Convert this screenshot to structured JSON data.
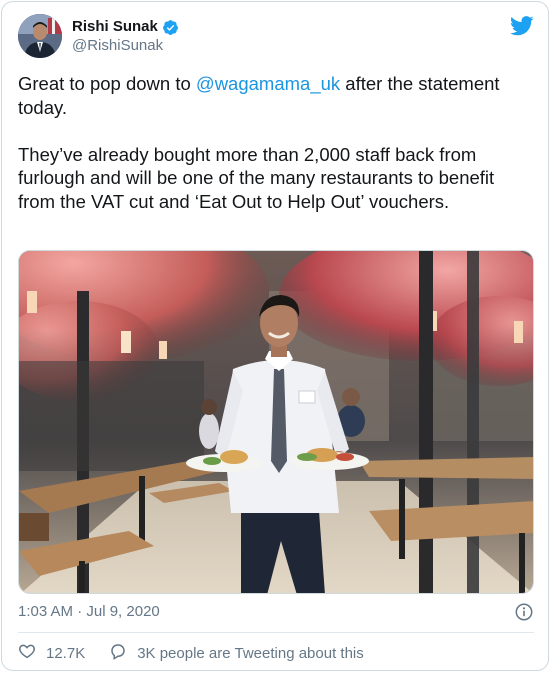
{
  "tweet": {
    "author_name": "Rishi Sunak",
    "author_handle": "@RishiSunak",
    "text_before_mention": "Great to pop down to ",
    "mention": "@wagamama_uk",
    "text_after_mention": " after the statement today.\n\nThey’ve already bought more than 2,000 staff back from furlough and will be one of the many restaurants to benefit from the VAT cut and ‘Eat Out to Help Out’ vouchers.",
    "timestamp": "1:03 AM · Jul 9, 2020",
    "likes": "12.7K",
    "conversation": "3K people are Tweeting about this"
  },
  "icons": {
    "verified": "verified-badge-icon",
    "brand": "twitter-bird-icon",
    "info": "info-icon",
    "like": "heart-icon",
    "reply": "speech-bubble-icon"
  },
  "colors": {
    "link": "#1b95e0",
    "twitter_blue": "#1da1f2",
    "secondary_text": "#657786",
    "border": "#cfd9de"
  }
}
